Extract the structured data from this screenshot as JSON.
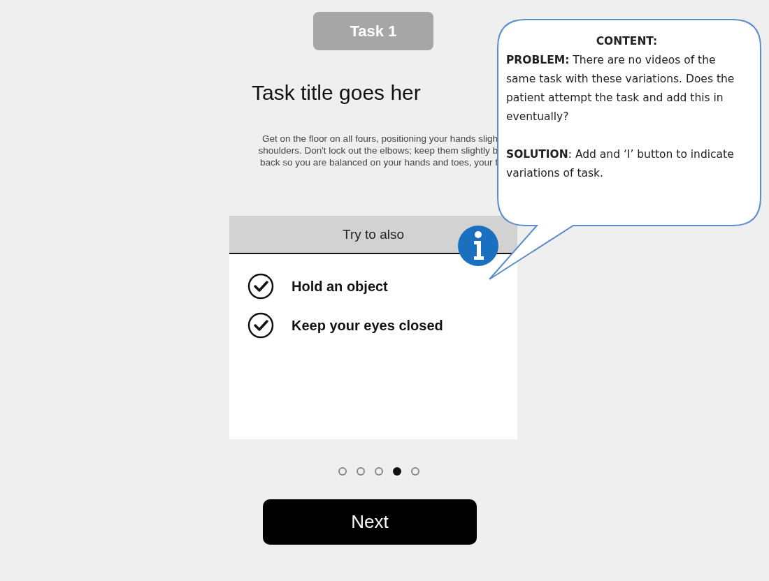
{
  "task_badge": "Task 1",
  "title": "Task title goes her",
  "description_lines": [
    "Get on the floor on all fours, positioning your hands sligh",
    "shoulders. Don't lock out the elbows; keep them slightly b",
    "back so you are balanced on your hands and toes, your f"
  ],
  "card": {
    "header": "Try to also",
    "items": [
      {
        "label": "Hold an object",
        "checked": true
      },
      {
        "label": "Keep your eyes closed",
        "checked": true
      }
    ]
  },
  "pager": [
    {
      "selected": false
    },
    {
      "selected": false
    },
    {
      "selected": false
    },
    {
      "selected": true
    },
    {
      "selected": false
    }
  ],
  "next_button": "Next",
  "callout": {
    "heading": "CONTENT:",
    "paragraphs": [
      "**PROBLEM:** There are no videos of the same task with these variations. Does the patient attempt the task and add this in eventually?",
      "**SOLUTION**: Add and ‘I’ button to indicate variations of task."
    ]
  }
}
